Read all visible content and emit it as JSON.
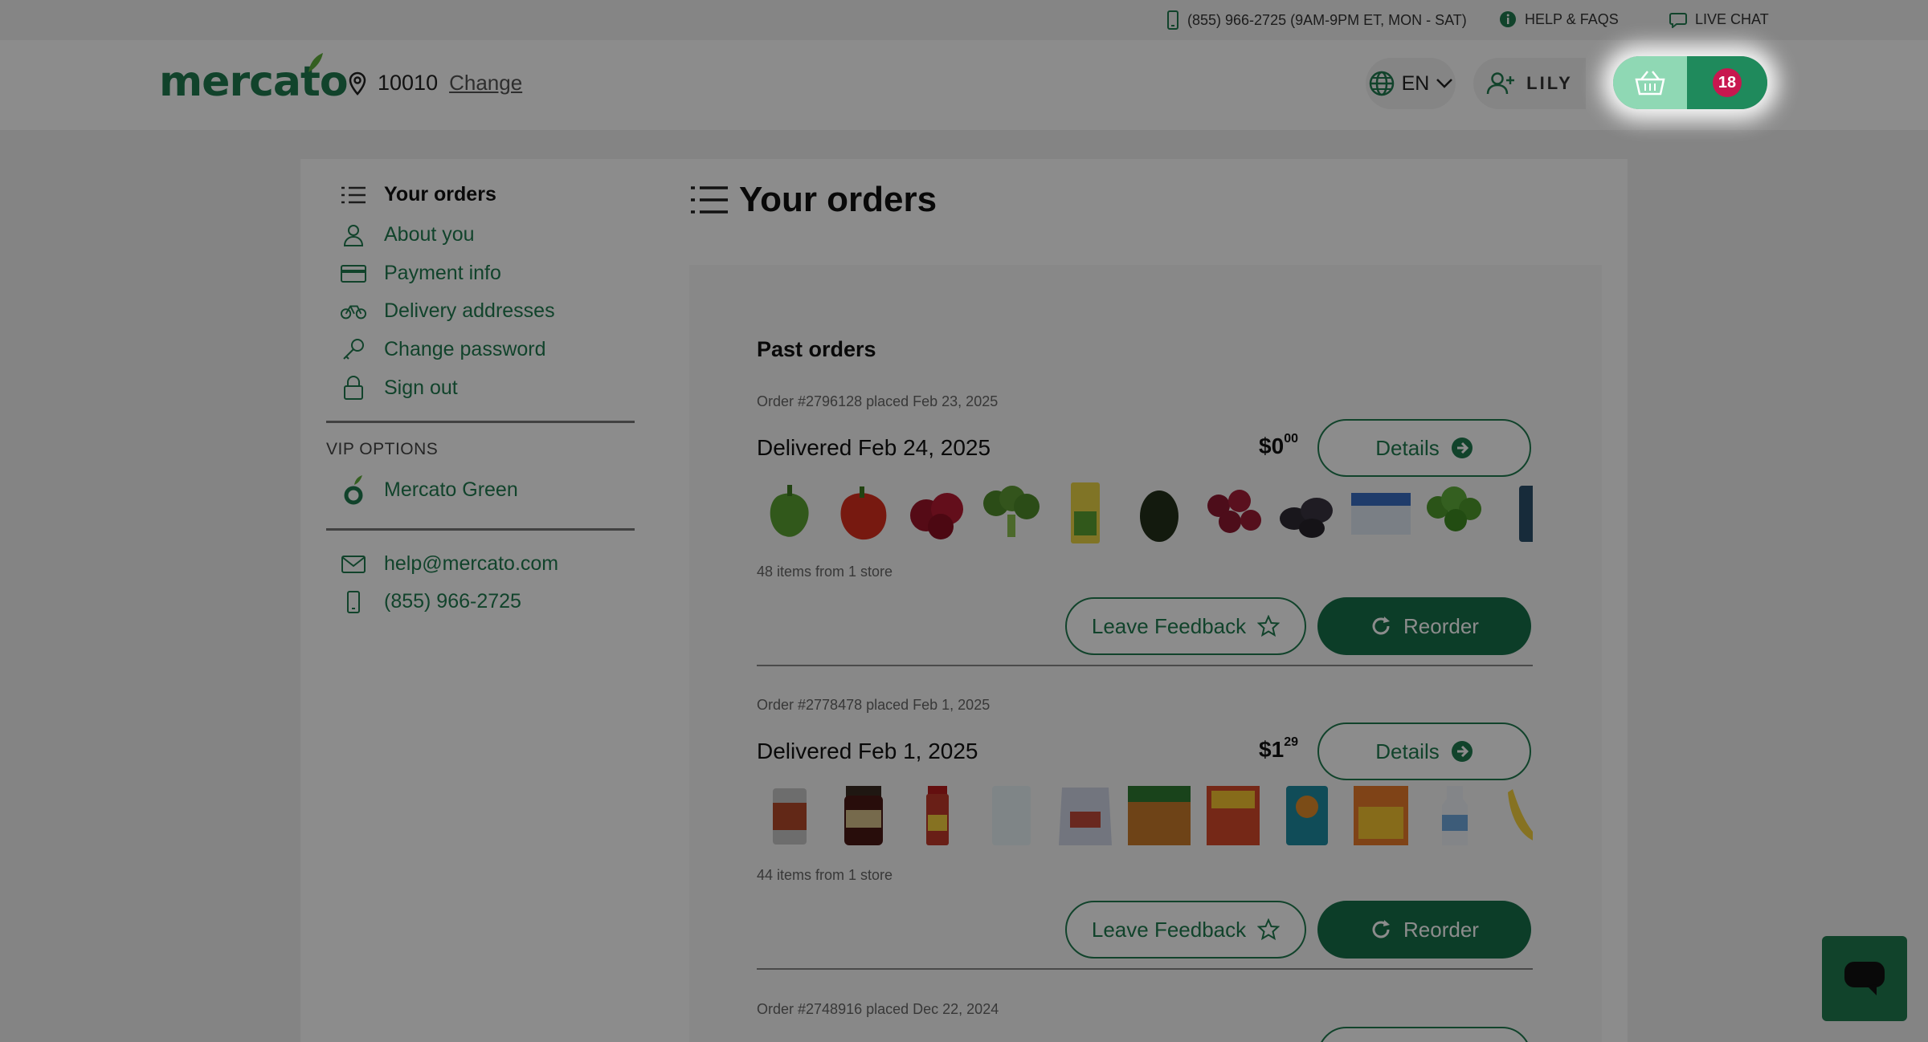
{
  "topbar": {
    "phone": "(855) 966-2725 (9AM-9PM ET, MON - SAT)",
    "help": "HELP & FAQS",
    "chat": "LIVE CHAT"
  },
  "header": {
    "logo": "mercato",
    "zip": "10010",
    "change": "Change",
    "language": "EN",
    "user": "LILY",
    "cart_count": "18"
  },
  "sidebar": {
    "items": [
      {
        "label": "Your orders",
        "icon": "list-icon"
      },
      {
        "label": "About you",
        "icon": "person-icon"
      },
      {
        "label": "Payment info",
        "icon": "credit-card-icon"
      },
      {
        "label": "Delivery addresses",
        "icon": "bicycle-icon"
      },
      {
        "label": "Change password",
        "icon": "key-icon"
      },
      {
        "label": "Sign out",
        "icon": "lock-icon"
      }
    ],
    "vip_label": "VIP OPTIONS",
    "vip_item": "Mercato Green",
    "email": "help@mercato.com",
    "phone": "(855) 966-2725"
  },
  "main": {
    "title": "Your orders",
    "past_title": "Past orders",
    "orders": [
      {
        "meta": "Order #2796128 placed Feb 23, 2025",
        "delivered": "Delivered Feb 24, 2025",
        "price_whole": "$0",
        "price_cents": "00",
        "items": "48 items from 1 store",
        "details": "Details",
        "feedback": "Leave Feedback",
        "reorder": "Reorder"
      },
      {
        "meta": "Order #2778478 placed Feb 1, 2025",
        "delivered": "Delivered Feb 1, 2025",
        "price_whole": "$1",
        "price_cents": "29",
        "items": "44 items from 1 store",
        "details": "Details",
        "feedback": "Leave Feedback",
        "reorder": "Reorder"
      },
      {
        "meta": "Order #2748916 placed Dec 22, 2024"
      }
    ]
  },
  "colors": {
    "brand": "#1f7a4f",
    "cart_light": "#8fd8b4",
    "cart_dark": "#1f8a5c",
    "badge": "#c8174f"
  }
}
